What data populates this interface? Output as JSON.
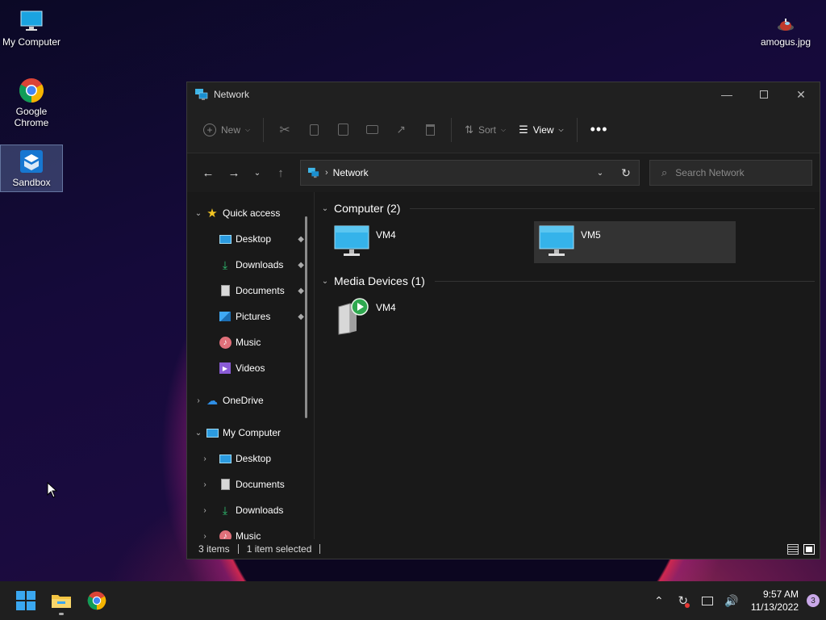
{
  "desktop": {
    "icons": [
      {
        "label": "My Computer"
      },
      {
        "label": "Google Chrome"
      },
      {
        "label": "Sandbox"
      },
      {
        "label": "amogus.jpg"
      }
    ]
  },
  "window": {
    "title": "Network",
    "toolbar": {
      "new_label": "New",
      "sort_label": "Sort",
      "view_label": "View"
    },
    "address": {
      "crumb": "Network"
    },
    "search": {
      "placeholder": "Search Network"
    },
    "nav": {
      "quick_access": "Quick access",
      "qa_items": [
        "Desktop",
        "Downloads",
        "Documents",
        "Pictures",
        "Music",
        "Videos"
      ],
      "onedrive": "OneDrive",
      "my_computer": "My Computer",
      "mc_items": [
        "Desktop",
        "Documents",
        "Downloads",
        "Music"
      ]
    },
    "groups": [
      {
        "title": "Computer (2)",
        "items": [
          "VM4",
          "VM5"
        ]
      },
      {
        "title": "Media Devices (1)",
        "items": [
          "VM4"
        ]
      }
    ],
    "status": {
      "items": "3 items",
      "selected": "1 item selected"
    }
  },
  "taskbar": {
    "time": "9:57 AM",
    "date": "11/13/2022",
    "notifications": "3"
  },
  "colors": {
    "accent": "#0078d4",
    "window_bg": "#191919",
    "selected": "#333333"
  }
}
